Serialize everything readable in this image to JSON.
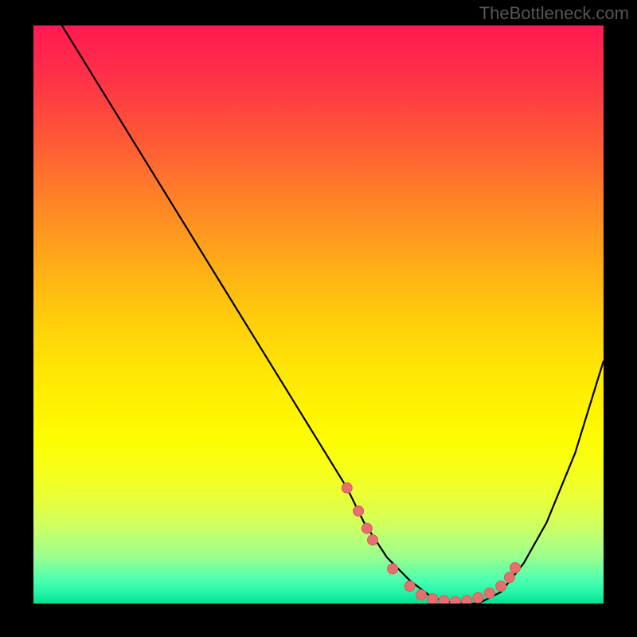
{
  "watermark": "TheBottleneck.com",
  "colors": {
    "background": "#000000",
    "curve": "#000000",
    "point_fill": "#e76f6f",
    "point_stroke": "#d85a5a"
  },
  "chart_data": {
    "type": "line",
    "title": "",
    "xlabel": "",
    "ylabel": "",
    "xlim": [
      0,
      100
    ],
    "ylim": [
      0,
      100
    ],
    "series": [
      {
        "name": "curve",
        "x": [
          5,
          10,
          15,
          20,
          25,
          30,
          35,
          40,
          45,
          50,
          55,
          58,
          62,
          66,
          70,
          74,
          78,
          82,
          86,
          90,
          95,
          100
        ],
        "y": [
          100,
          92,
          84,
          76,
          68,
          60,
          52,
          44,
          36,
          28,
          20,
          14,
          8,
          4,
          1,
          0,
          0,
          2,
          7,
          14,
          26,
          42
        ]
      }
    ],
    "scatter_points": {
      "name": "highlighted-points",
      "x": [
        55,
        57,
        58.5,
        59.5,
        63,
        66,
        68,
        70,
        72,
        74,
        76,
        78,
        80,
        82,
        83.5,
        84.5
      ],
      "y": [
        20,
        16,
        13,
        11,
        6,
        3,
        1.5,
        0.8,
        0.5,
        0.3,
        0.5,
        1,
        1.8,
        3,
        4.5,
        6.2
      ]
    }
  }
}
